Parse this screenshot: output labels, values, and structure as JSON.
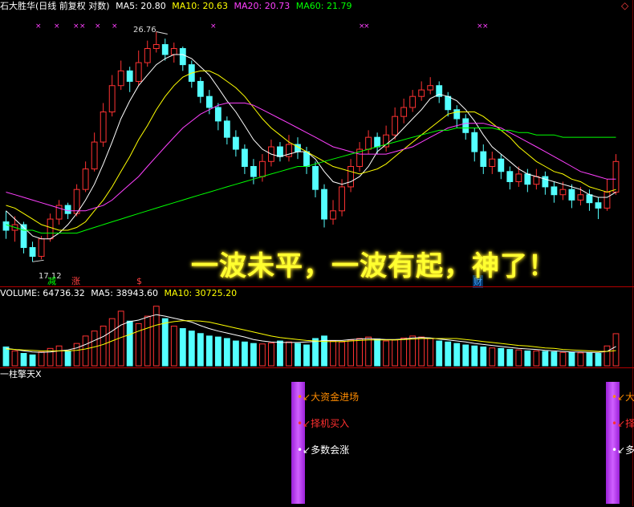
{
  "header": {
    "stock": "石大胜华(日线 前复权 对数)",
    "ma": [
      {
        "label": "MA5: 20.80",
        "color": "#ffffff"
      },
      {
        "label": "MA10: 20.63",
        "color": "#ffff00"
      },
      {
        "label": "MA20: 20.73",
        "color": "#ff40ff"
      },
      {
        "label": "MA60: 21.79",
        "color": "#00ff00"
      }
    ],
    "corner_icon": "◇"
  },
  "annotations": {
    "high_label": "26.76",
    "low_label": "17.12",
    "banner": "一波未平，一波有起，神了！",
    "tags": [
      {
        "text": "减",
        "color": "#00ff00"
      },
      {
        "text": "涨",
        "color": "#ff4040"
      },
      {
        "text": "$",
        "color": "#ff4040"
      },
      {
        "text": "财",
        "color": "#40a0ff"
      }
    ]
  },
  "volume_header": [
    {
      "label": "VOLUME: 64736.32",
      "color": "#ffffff"
    },
    {
      "label": "MA5: 38943.60",
      "color": "#ffffff"
    },
    {
      "label": "MA10: 30725.20",
      "color": "#ffff00"
    }
  ],
  "indicator": {
    "title": "一柱擎天X",
    "signals": [
      {
        "text": "大资金进场",
        "color": "#ff8c00"
      },
      {
        "text": "择机买入",
        "color": "#ff3030"
      },
      {
        "text": "多数会涨",
        "color": "#ffffff"
      }
    ],
    "partial_signals": [
      "大",
      "择",
      "多"
    ]
  },
  "chart_data": {
    "type": "candlestick",
    "price_range": [
      16.5,
      27.5
    ],
    "high": 26.76,
    "low": 17.12,
    "candles": [
      [
        18.5,
        18.2,
        18.9,
        17.9
      ],
      [
        18.2,
        18.4,
        18.7,
        17.8
      ],
      [
        18.4,
        17.6,
        18.5,
        17.4
      ],
      [
        17.6,
        17.3,
        17.8,
        17.12
      ],
      [
        17.3,
        17.9,
        18.0,
        17.2
      ],
      [
        17.9,
        18.6,
        18.8,
        17.8
      ],
      [
        18.6,
        19.1,
        19.3,
        18.4
      ],
      [
        19.1,
        18.8,
        19.2,
        18.6
      ],
      [
        18.8,
        19.7,
        19.9,
        18.7
      ],
      [
        19.7,
        20.5,
        20.8,
        19.6
      ],
      [
        20.5,
        21.6,
        22.0,
        20.4
      ],
      [
        21.6,
        22.9,
        23.3,
        21.4
      ],
      [
        22.9,
        24.1,
        24.6,
        22.7
      ],
      [
        24.1,
        24.8,
        25.3,
        23.9
      ],
      [
        24.8,
        24.3,
        25.0,
        23.8
      ],
      [
        24.3,
        25.2,
        25.8,
        24.1
      ],
      [
        25.2,
        25.9,
        26.3,
        25.0
      ],
      [
        25.9,
        26.1,
        26.76,
        25.7
      ],
      [
        26.1,
        25.6,
        26.4,
        25.3
      ],
      [
        25.6,
        25.9,
        26.2,
        25.2
      ],
      [
        25.9,
        25.1,
        26.0,
        24.8
      ],
      [
        25.1,
        24.3,
        25.3,
        24.0
      ],
      [
        24.3,
        23.6,
        24.5,
        23.3
      ],
      [
        23.6,
        23.1,
        23.9,
        22.8
      ],
      [
        23.1,
        22.5,
        23.3,
        22.1
      ],
      [
        22.5,
        21.8,
        22.7,
        21.5
      ],
      [
        21.8,
        21.3,
        22.1,
        21.0
      ],
      [
        21.3,
        20.6,
        21.5,
        20.3
      ],
      [
        20.6,
        20.2,
        20.9,
        19.9
      ],
      [
        20.2,
        20.8,
        21.1,
        20.0
      ],
      [
        20.8,
        21.4,
        21.7,
        20.6
      ],
      [
        21.4,
        21.0,
        21.6,
        20.8
      ],
      [
        21.0,
        21.5,
        21.9,
        20.8
      ],
      [
        21.5,
        21.2,
        21.8,
        20.9
      ],
      [
        21.2,
        20.6,
        21.4,
        20.3
      ],
      [
        20.6,
        19.7,
        20.8,
        19.4
      ],
      [
        19.7,
        18.6,
        19.9,
        18.3
      ],
      [
        18.6,
        18.9,
        19.3,
        18.4
      ],
      [
        18.9,
        19.8,
        20.1,
        18.7
      ],
      [
        19.8,
        20.6,
        20.9,
        19.6
      ],
      [
        20.6,
        21.3,
        21.6,
        20.4
      ],
      [
        21.3,
        21.8,
        22.1,
        21.1
      ],
      [
        21.8,
        21.4,
        22.0,
        21.1
      ],
      [
        21.4,
        21.9,
        22.3,
        21.2
      ],
      [
        21.9,
        22.7,
        23.1,
        21.7
      ],
      [
        22.7,
        23.1,
        23.5,
        22.4
      ],
      [
        23.1,
        23.6,
        23.9,
        22.9
      ],
      [
        23.6,
        23.9,
        24.3,
        23.4
      ],
      [
        23.9,
        24.1,
        24.5,
        23.7
      ],
      [
        24.1,
        23.6,
        24.3,
        23.3
      ],
      [
        23.6,
        23.0,
        23.8,
        22.7
      ],
      [
        23.0,
        22.6,
        23.2,
        22.2
      ],
      [
        22.6,
        22.0,
        22.8,
        21.7
      ],
      [
        22.0,
        21.2,
        22.2,
        20.8
      ],
      [
        21.2,
        20.6,
        21.5,
        20.3
      ],
      [
        20.6,
        20.9,
        21.2,
        20.3
      ],
      [
        20.9,
        20.4,
        21.1,
        20.1
      ],
      [
        20.4,
        20.0,
        20.6,
        19.7
      ],
      [
        20.0,
        20.3,
        20.6,
        19.8
      ],
      [
        20.3,
        19.9,
        20.5,
        19.6
      ],
      [
        19.9,
        20.2,
        20.5,
        19.7
      ],
      [
        20.2,
        19.8,
        20.4,
        19.5
      ],
      [
        19.8,
        19.5,
        20.0,
        19.2
      ],
      [
        19.5,
        19.7,
        20.0,
        19.3
      ],
      [
        19.7,
        19.3,
        19.9,
        19.0
      ],
      [
        19.3,
        19.5,
        19.8,
        19.1
      ],
      [
        19.5,
        19.2,
        19.7,
        18.9
      ],
      [
        19.2,
        19.0,
        19.4,
        18.6
      ],
      [
        19.0,
        19.6,
        20.1,
        18.9
      ],
      [
        19.6,
        20.8,
        21.1,
        19.5
      ]
    ],
    "ma_series": [
      {
        "name": "MA5",
        "color": "#ffffff",
        "values": [
          18.9,
          18.6,
          18.3,
          18.0,
          17.9,
          17.9,
          18.1,
          18.4,
          18.8,
          19.3,
          19.9,
          20.7,
          21.6,
          22.6,
          23.4,
          24.1,
          24.6,
          25.1,
          25.4,
          25.6,
          25.6,
          25.4,
          25.0,
          24.6,
          24.0,
          23.4,
          22.9,
          22.3,
          21.7,
          21.3,
          21.1,
          21.0,
          21.1,
          21.2,
          21.2,
          20.9,
          20.4,
          20.0,
          19.9,
          20.0,
          20.2,
          20.6,
          21.2,
          21.5,
          21.8,
          22.2,
          22.6,
          23.0,
          23.5,
          23.7,
          23.6,
          23.4,
          23.0,
          22.5,
          21.9,
          21.4,
          21.1,
          20.8,
          20.5,
          20.3,
          20.2,
          20.1,
          20.0,
          19.9,
          19.8,
          19.7,
          19.5,
          19.4,
          19.4,
          19.6
        ]
      },
      {
        "name": "MA10",
        "color": "#ffff00",
        "values": [
          19.1,
          19.0,
          18.8,
          18.6,
          18.4,
          18.3,
          18.2,
          18.2,
          18.3,
          18.5,
          18.9,
          19.3,
          19.8,
          20.4,
          21.0,
          21.7,
          22.3,
          23.0,
          23.6,
          24.1,
          24.5,
          24.7,
          24.8,
          24.8,
          24.6,
          24.3,
          24.0,
          23.6,
          23.1,
          22.6,
          22.2,
          21.9,
          21.6,
          21.4,
          21.2,
          21.0,
          20.8,
          20.6,
          20.5,
          20.4,
          20.3,
          20.4,
          20.5,
          20.7,
          21.0,
          21.3,
          21.6,
          21.9,
          22.2,
          22.5,
          22.8,
          22.9,
          22.9,
          22.9,
          22.7,
          22.4,
          22.1,
          21.8,
          21.4,
          21.1,
          20.8,
          20.6,
          20.4,
          20.3,
          20.1,
          20.0,
          19.8,
          19.7,
          19.6,
          19.7
        ]
      },
      {
        "name": "MA20",
        "color": "#ff40ff",
        "values": [
          19.6,
          19.5,
          19.4,
          19.3,
          19.2,
          19.1,
          19.0,
          18.9,
          18.9,
          18.9,
          19.0,
          19.1,
          19.3,
          19.6,
          19.9,
          20.2,
          20.6,
          21.0,
          21.4,
          21.8,
          22.2,
          22.5,
          22.8,
          23.0,
          23.2,
          23.3,
          23.3,
          23.3,
          23.2,
          23.0,
          22.8,
          22.6,
          22.4,
          22.2,
          22.0,
          21.8,
          21.6,
          21.4,
          21.3,
          21.2,
          21.1,
          21.1,
          21.1,
          21.1,
          21.2,
          21.3,
          21.4,
          21.6,
          21.8,
          22.0,
          22.2,
          22.3,
          22.4,
          22.4,
          22.4,
          22.3,
          22.2,
          22.0,
          21.8,
          21.6,
          21.4,
          21.2,
          21.0,
          20.8,
          20.6,
          20.4,
          20.3,
          20.2,
          20.1,
          20.1
        ]
      },
      {
        "name": "MA60",
        "color": "#00ff00",
        "values": [
          18.4,
          18.3,
          18.2,
          18.2,
          18.1,
          18.1,
          18.1,
          18.1,
          18.1,
          18.2,
          18.3,
          18.4,
          18.5,
          18.6,
          18.7,
          18.8,
          18.9,
          19.0,
          19.1,
          19.2,
          19.3,
          19.4,
          19.5,
          19.6,
          19.7,
          19.8,
          19.9,
          20.0,
          20.1,
          20.2,
          20.3,
          20.4,
          20.5,
          20.6,
          20.6,
          20.7,
          20.8,
          20.9,
          21.0,
          21.1,
          21.2,
          21.3,
          21.4,
          21.5,
          21.6,
          21.7,
          21.8,
          21.9,
          22.0,
          22.1,
          22.1,
          22.2,
          22.2,
          22.2,
          22.2,
          22.2,
          22.1,
          22.1,
          22.0,
          22.0,
          21.9,
          21.9,
          21.9,
          21.8,
          21.8,
          21.8,
          21.8,
          21.8,
          21.8,
          21.8
        ]
      }
    ],
    "volume": [
      38,
      30,
      25,
      22,
      28,
      35,
      40,
      30,
      45,
      60,
      70,
      80,
      95,
      110,
      90,
      85,
      100,
      120,
      95,
      80,
      75,
      70,
      65,
      60,
      58,
      55,
      50,
      48,
      45,
      44,
      46,
      50,
      48,
      45,
      42,
      55,
      60,
      50,
      48,
      52,
      55,
      58,
      54,
      50,
      52,
      56,
      60,
      58,
      55,
      50,
      48,
      45,
      42,
      40,
      38,
      36,
      35,
      33,
      32,
      30,
      30,
      29,
      28,
      27,
      27,
      26,
      26,
      25,
      40,
      64.7
    ],
    "volume_ma5": [
      35,
      33,
      30,
      28,
      27,
      28,
      30,
      32,
      36,
      43,
      51,
      59,
      70,
      82,
      89,
      92,
      98,
      103,
      100,
      96,
      92,
      88,
      81,
      75,
      70,
      66,
      62,
      58,
      53,
      50,
      48,
      47,
      47,
      47,
      48,
      49,
      51,
      51,
      51,
      53,
      54,
      55,
      54,
      53,
      53,
      54,
      56,
      57,
      56,
      54,
      52,
      50,
      48,
      45,
      43,
      41,
      39,
      37,
      35,
      34,
      33,
      31,
      30,
      29,
      28,
      28,
      27,
      27,
      29,
      38.9
    ],
    "volume_ma10": [
      34,
      33,
      32,
      31,
      30,
      30,
      30,
      30,
      31,
      34,
      38,
      43,
      50,
      57,
      63,
      70,
      76,
      82,
      86,
      89,
      91,
      91,
      90,
      88,
      84,
      80,
      76,
      72,
      68,
      64,
      60,
      57,
      55,
      53,
      51,
      50,
      49,
      49,
      49,
      50,
      51,
      52,
      52,
      52,
      52,
      53,
      54,
      55,
      55,
      55,
      55,
      55,
      53,
      51,
      49,
      47,
      45,
      43,
      41,
      40,
      38,
      36,
      35,
      33,
      32,
      31,
      30,
      29,
      29,
      30.7
    ]
  }
}
